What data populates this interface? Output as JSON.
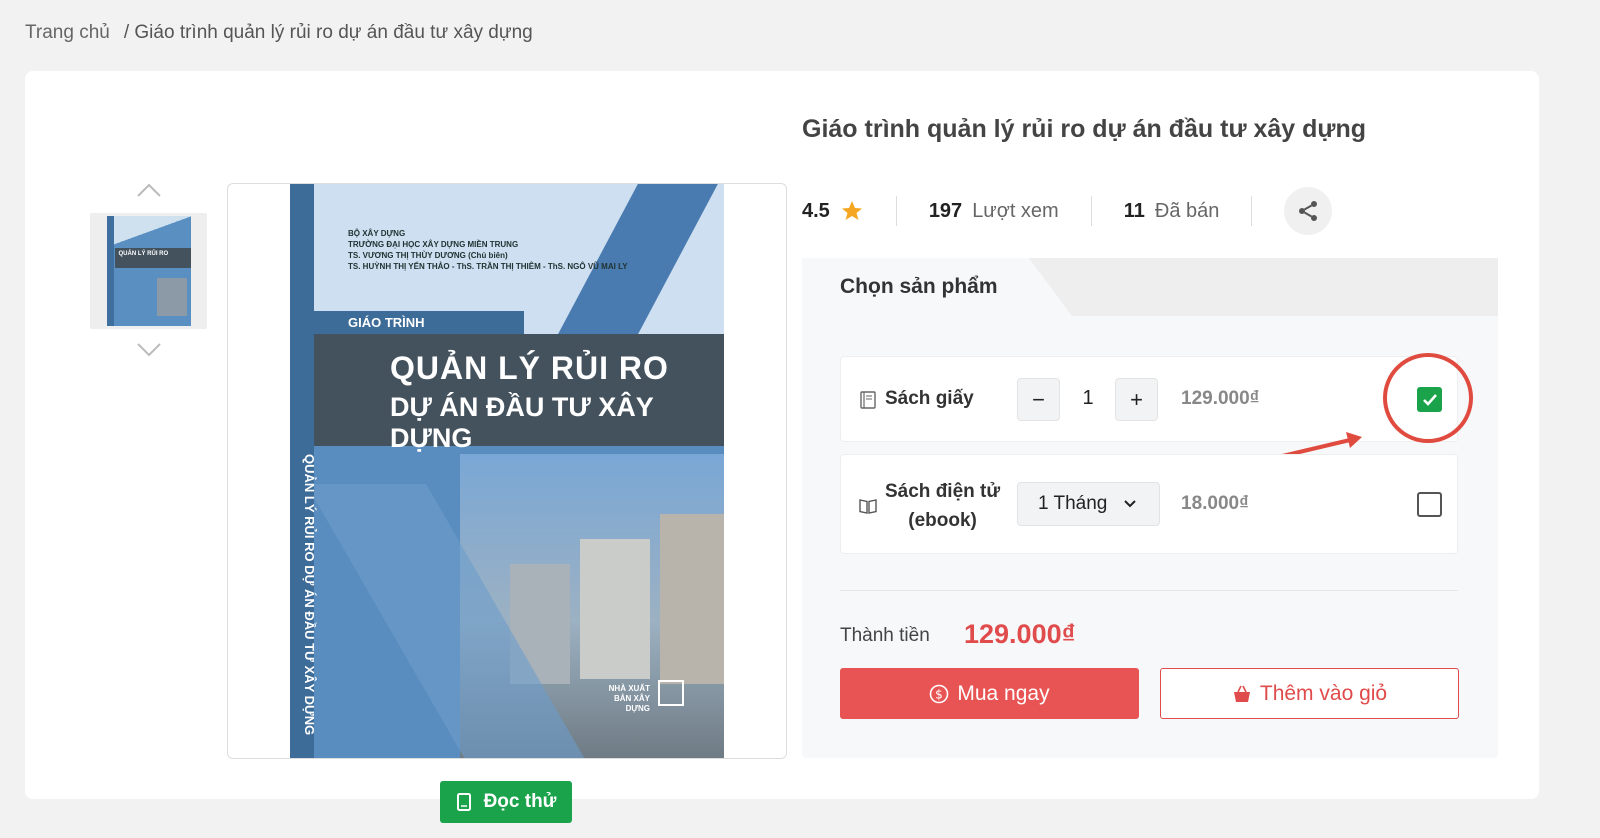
{
  "breadcrumb": {
    "home": "Trang chủ",
    "current": "/ Giáo trình quản lý rủi ro dự án đầu tư xây dựng"
  },
  "product": {
    "title": "Giáo trình quản lý rủi ro dự án đầu tư xây dựng",
    "rating": "4.5",
    "views_count": "197",
    "views_label": "Lượt xem",
    "sold_count": "11",
    "sold_label": "Đã bán"
  },
  "cover": {
    "credits": [
      "BỘ XÂY DỰNG",
      "TRƯỜNG ĐẠI HỌC XÂY DỰNG MIỀN TRUNG",
      "TS. VƯƠNG THỊ THÙY DƯƠNG (Chủ biên)",
      "TS. HUỲNH THỊ YẾN THẢO - ThS. TRẦN THỊ THIÊM - ThS. NGÔ VŨ MAI LY"
    ],
    "series": "GIÁO TRÌNH",
    "title_line1": "QUẢN LÝ RỦI RO",
    "title_line2": "DỰ ÁN ĐẦU TƯ XÂY DỰNG",
    "spine_text": "QUẢN LÝ RỦI RO DỰ ÁN ĐẦU TƯ XÂY DỰNG",
    "publisher": "NHÀ XUẤT BẢN XÂY DỰNG"
  },
  "read_button": "Đọc thử",
  "selector": {
    "tab_label": "Chọn sản phẩm",
    "paper": {
      "label": "Sách giấy",
      "quantity": "1",
      "minus": "−",
      "plus": "+",
      "price": "129.000₫",
      "checked": true
    },
    "ebook": {
      "label_line1": "Sách điện tử",
      "label_line2": "(ebook)",
      "duration": "1 Tháng",
      "price": "18.000₫",
      "checked": false
    }
  },
  "total": {
    "label": "Thành tiền",
    "value": "129.000₫"
  },
  "buttons": {
    "buy_now": "Mua ngay",
    "add_to_cart": "Thêm vào giỏ"
  },
  "colors": {
    "accent_red": "#e85453",
    "green": "#1aa34a",
    "star": "#f5a623"
  },
  "icons": {
    "star": "star-icon",
    "share": "share-icon",
    "book": "book-icon",
    "open_book": "open-book-icon",
    "dollar": "dollar-circle-icon",
    "basket": "basket-icon",
    "chevron_up": "chevron-up-icon",
    "chevron_down": "chevron-down-icon"
  }
}
